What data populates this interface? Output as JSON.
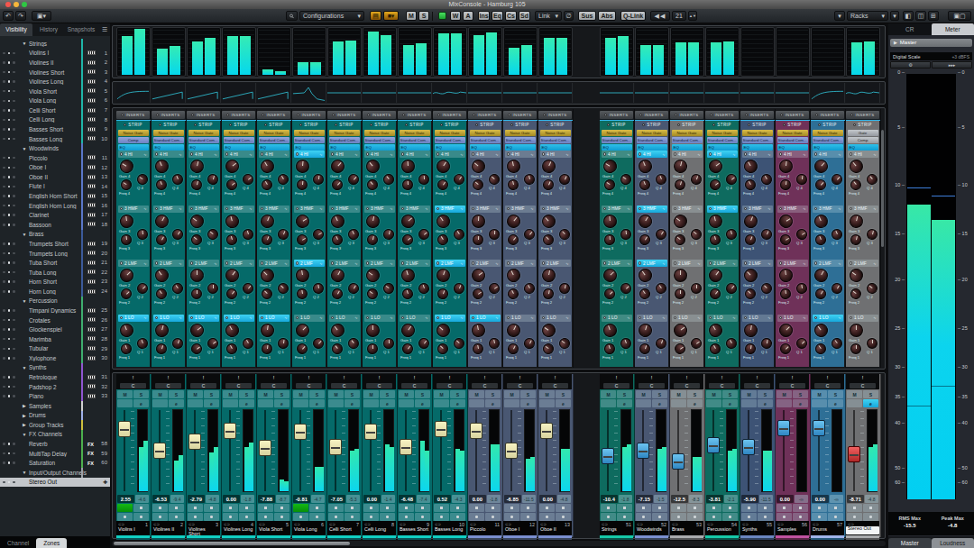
{
  "window": {
    "title": "MixConsole - Hamburg 105"
  },
  "toolbar": {
    "configurations": "Configurations",
    "m": "M",
    "s": "S",
    "w": "W",
    "a": "A",
    "ins": "Ins",
    "eq": "Eq",
    "cs": "Cs",
    "sd": "Sd",
    "link": "Link",
    "sus": "Sus",
    "abs": "Abs",
    "qlink": "Q-Link",
    "count": "21",
    "racks": "Racks"
  },
  "sidebar": {
    "tabs": [
      "Visibility",
      "History",
      "Snapshots"
    ],
    "bottom_tabs": [
      "Channel",
      "Zones"
    ],
    "rows": [
      [
        "g",
        "Strings",
        "",
        "teal"
      ],
      [
        "t",
        "Violins I",
        "1",
        "teal"
      ],
      [
        "t",
        "Violines II",
        "2",
        "teal"
      ],
      [
        "t",
        "Violines Short",
        "3",
        "teal"
      ],
      [
        "t",
        "Violines Long",
        "4",
        "teal"
      ],
      [
        "t",
        "Viola Short",
        "5",
        "teal"
      ],
      [
        "t",
        "Viola Long",
        "6",
        "teal"
      ],
      [
        "t",
        "Celli Short",
        "7",
        "teal"
      ],
      [
        "t",
        "Celli Long",
        "8",
        "teal"
      ],
      [
        "t",
        "Basses Short",
        "9",
        "teal"
      ],
      [
        "t",
        "Basses Long",
        "10",
        "teal"
      ],
      [
        "g",
        "Woodwinds",
        "",
        "slate"
      ],
      [
        "t",
        "Piccolo",
        "11",
        "slate"
      ],
      [
        "t",
        "Oboe I",
        "12",
        "slate"
      ],
      [
        "t",
        "Oboe II",
        "13",
        "slate"
      ],
      [
        "t",
        "Flute I",
        "14",
        "slate"
      ],
      [
        "t",
        "English Horn Short",
        "15",
        "slate"
      ],
      [
        "t",
        "English Horn Long",
        "16",
        "slate"
      ],
      [
        "t",
        "Clarinet",
        "17",
        "slate"
      ],
      [
        "t",
        "Bassoon",
        "18",
        "slate"
      ],
      [
        "g",
        "Brass",
        "",
        "navy"
      ],
      [
        "t",
        "Trumpets Short",
        "19",
        "navy"
      ],
      [
        "t",
        "Trumpets Long",
        "20",
        "navy"
      ],
      [
        "t",
        "Tuba Short",
        "21",
        "navy"
      ],
      [
        "t",
        "Tuba Long",
        "22",
        "navy"
      ],
      [
        "t",
        "Horn Short",
        "23",
        "navy"
      ],
      [
        "t",
        "Horn Long",
        "24",
        "navy"
      ],
      [
        "g",
        "Percussion",
        "",
        "green"
      ],
      [
        "t",
        "Timpani Dynamics",
        "25",
        "green"
      ],
      [
        "t",
        "Crotales",
        "26",
        "green"
      ],
      [
        "t",
        "Glockenspiel",
        "27",
        "green"
      ],
      [
        "t",
        "Marimba",
        "28",
        "green"
      ],
      [
        "t",
        "Tubular",
        "29",
        "green"
      ],
      [
        "t",
        "Xylophone",
        "30",
        "green"
      ],
      [
        "g",
        "Synths",
        "",
        "purple"
      ],
      [
        "t",
        "Retrologue",
        "31",
        "purple"
      ],
      [
        "t",
        "Padshop 2",
        "32",
        "purple"
      ],
      [
        "t",
        "Piano",
        "33",
        "purple"
      ],
      [
        "c",
        "Samples",
        "",
        "white"
      ],
      [
        "c",
        "Drums",
        "",
        "lav"
      ],
      [
        "c",
        "Group Tracks",
        "",
        "yellow"
      ],
      [
        "g",
        "FX Channels",
        "",
        "fxgreen"
      ],
      [
        "f",
        "Reverb",
        "58",
        "fxgreen"
      ],
      [
        "f",
        "MultiTap Delay",
        "59",
        "fxgreen"
      ],
      [
        "f",
        "Saturation",
        "60",
        "fxgreen"
      ],
      [
        "g",
        "Input/Output Channels",
        "",
        "io"
      ],
      [
        "s",
        "Stereo Out",
        "",
        "io"
      ]
    ],
    "strip_colors": {
      "teal": "#1fb5a8",
      "slate": "#5a77c8",
      "navy": "#3c5a9a",
      "green": "#3fae6e",
      "purple": "#9055d0",
      "white": "#cfcfcf",
      "lav": "#9fb0e8",
      "yellow": "#cdbf3e",
      "fxgreen": "#4db04d",
      "io": "#9aa0a6"
    }
  },
  "racks": {
    "inserts_label": "INSERTS",
    "strip_label": "STRIP",
    "bands": [
      {
        "id": "4 HI",
        "gain": "Gain 4",
        "freq": "Freq 4",
        "q": "Q 4"
      },
      {
        "id": "3 HMF",
        "gain": "Gain 3",
        "freq": "Freq 3",
        "q": "Q 3"
      },
      {
        "id": "2 LMF",
        "gain": "Gain 2",
        "freq": "Freq 2",
        "q": "Q 2"
      },
      {
        "id": "1 LO",
        "gain": "Gain 1",
        "freq": "Freq 1",
        "q": "Q 1"
      }
    ]
  },
  "mixer": {
    "colors": {
      "teal": {
        "base": "#056a69",
        "dark": "#03393c",
        "mid": "#0a5256",
        "bright": "#11cfc3"
      },
      "slate": {
        "base": "#495772",
        "dark": "#272e40",
        "mid": "#394459",
        "bright": "#7a8fd0"
      },
      "grey": {
        "base": "#6f7072",
        "dark": "#3b3c3e",
        "mid": "#545557",
        "bright": "#a9abae"
      },
      "green": {
        "base": "#0e6b5f",
        "dark": "#073a33",
        "mid": "#0b5249",
        "bright": "#16c9a8"
      },
      "navy": {
        "base": "#3d5375",
        "dark": "#202c42",
        "mid": "#2f405c",
        "bright": "#6a86c0"
      },
      "magenta": {
        "base": "#6f3159",
        "dark": "#3e1a31",
        "mid": "#572645",
        "bright": "#c052a0"
      },
      "blue": {
        "base": "#2e6f96",
        "dark": "#183f58",
        "mid": "#235676",
        "bright": "#9fb4ea"
      }
    },
    "channels": [
      {
        "name": "Violins I",
        "num": "1",
        "color": "teal",
        "cap": "cream",
        "mods": [
          "Noise Gate",
          "Comp",
          "EQ"
        ],
        "br": [
          78,
          92
        ],
        "m": [
          55,
          62
        ],
        "f": 0.18,
        "v": "2.55",
        "p": "-4.6",
        "mon": true,
        "hl": [
          1
        ],
        "auto": "rise"
      },
      {
        "name": "Violines II",
        "num": "2",
        "color": "teal",
        "cap": "cream",
        "mods": [
          "Noise Gate",
          "Standard Com...",
          "EQ"
        ],
        "br": [
          52,
          58
        ],
        "m": [
          38,
          45
        ],
        "f": 0.5,
        "v": "-6.53",
        "p": "-9.4",
        "hl": [
          1
        ],
        "auto": "ramp"
      },
      {
        "name": "Violines Short",
        "num": "3",
        "color": "teal",
        "cap": "cream",
        "mods": [
          "Noise Gate",
          "Standard Com...",
          "EQ"
        ],
        "br": [
          68,
          75
        ],
        "m": [
          48,
          55
        ],
        "f": 0.36,
        "v": "-2.79",
        "p": "-4.8",
        "hl": [
          1
        ],
        "auto": "ramp"
      },
      {
        "name": "Violines Long",
        "num": "4",
        "color": "teal",
        "cap": "cream",
        "mods": [
          "Noise Gate",
          "Standard Com...",
          "EQ"
        ],
        "br": [
          78,
          78
        ],
        "m": [
          55,
          60
        ],
        "f": 0.2,
        "v": "0.00",
        "p": "-1.8",
        "hl": [
          1
        ],
        "auto": "ramp"
      },
      {
        "name": "Viola Short",
        "num": "5",
        "color": "teal",
        "cap": "cream",
        "mods": [
          "Noise Gate",
          "Standard Com...",
          "EQ"
        ],
        "br": [
          11,
          8
        ],
        "m": [
          14,
          12
        ],
        "f": 0.46,
        "v": "-7.88",
        "p": "-8.7",
        "hl": [
          1
        ],
        "auto": "ramp"
      },
      {
        "name": "Viola Long",
        "num": "6",
        "color": "teal",
        "cap": "cream",
        "mods": [
          "Noise Gate",
          "Standard Com...",
          "EQ"
        ],
        "br": [
          26,
          26
        ],
        "m": [
          30,
          30
        ],
        "f": 0.22,
        "v": "-0.81",
        "p": "-4.7",
        "mon": true,
        "hl": [
          4,
          2
        ],
        "auto": "peak"
      },
      {
        "name": "Celli Short",
        "num": "7",
        "color": "teal",
        "cap": "cream",
        "mods": [
          "Noise Gate",
          "Standard Com...",
          "EQ"
        ],
        "br": [
          68,
          70
        ],
        "m": [
          50,
          52
        ],
        "f": 0.45,
        "v": "-7.05",
        "p": "-5.3",
        "auto": "flat"
      },
      {
        "name": "Celli Long",
        "num": "8",
        "color": "teal",
        "cap": "cream",
        "mods": [
          "Noise Gate",
          "Standard Com...",
          "EQ"
        ],
        "br": [
          88,
          80
        ],
        "m": [
          58,
          55
        ],
        "f": 0.22,
        "v": "0.00",
        "p": "-1.4",
        "auto": "flat"
      },
      {
        "name": "Basses Short",
        "num": "9",
        "color": "teal",
        "cap": "cream",
        "mods": [
          "Noise Gate",
          "Standard Com...",
          "EQ"
        ],
        "br": [
          60,
          63
        ],
        "m": [
          62,
          50
        ],
        "f": 0.45,
        "v": "-6.48",
        "p": "-7.4",
        "auto": "flat"
      },
      {
        "name": "Basses Long",
        "num": "10",
        "color": "teal",
        "cap": "cream",
        "mods": [
          "Noise Gate",
          "Standard Com...",
          "EQ"
        ],
        "br": [
          83,
          83
        ],
        "m": [
          52,
          50
        ],
        "f": 0.18,
        "v": "0.52",
        "p": "-4.3",
        "hl": [
          3,
          2,
          1
        ],
        "auto": "wave"
      },
      {
        "name": "Piccolo",
        "num": "11",
        "color": "slate",
        "cap": "cream",
        "mods": [
          "Noise Gate",
          "Standard Com...",
          "EQ"
        ],
        "br": [
          80,
          85
        ],
        "m": [
          58,
          58
        ],
        "f": 0.2,
        "v": "0.00",
        "p": "-1.8",
        "hl": [
          1
        ],
        "auto": "flat"
      },
      {
        "name": "Oboe I",
        "num": "12",
        "color": "slate",
        "cap": "cream",
        "mods": [
          "Noise Gate",
          "Standard Com...",
          "EQ"
        ],
        "br": [
          55,
          60
        ],
        "m": [
          40,
          42
        ],
        "f": 0.5,
        "v": "-6.85",
        "p": "-11.5",
        "auto": "flat"
      },
      {
        "name": "Oboe II",
        "num": "13",
        "color": "slate",
        "cap": "cream",
        "mods": [
          "Noise Gate",
          "Standard Com...",
          "EQ"
        ],
        "br": [
          75,
          75
        ],
        "m": [
          52,
          52
        ],
        "f": 0.2,
        "v": "0.00",
        "p": "-4.8",
        "auto": "flat"
      },
      {
        "name": "Strings",
        "num": "51",
        "color": "green",
        "cap": "bluecap",
        "grp2": true,
        "mods": [
          "Noise Gate",
          "Standard Com...",
          "EQ"
        ],
        "br": [
          75,
          78
        ],
        "m": [
          55,
          58
        ],
        "f": 0.58,
        "v": "-10.4",
        "p": "-1.8",
        "auto": "flat"
      },
      {
        "name": "Woodwinds",
        "num": "52",
        "color": "slate",
        "cap": "bluecap",
        "mods": [
          "Noise Gate",
          "Standard Com...",
          "EQ"
        ],
        "br": [
          60,
          60
        ],
        "m": [
          52,
          55
        ],
        "f": 0.5,
        "v": "-7.15",
        "p": "-1.5",
        "hl": [
          4,
          3,
          2
        ],
        "auto": "flat"
      },
      {
        "name": "Brass",
        "num": "53",
        "color": "grey",
        "cap": "bluecap",
        "mods": [
          "Noise Gate",
          "Standard Com...",
          "EQ"
        ],
        "br": [
          65,
          65
        ],
        "m": [
          42,
          42
        ],
        "f": 0.66,
        "v": "-12.5",
        "p": "-8.3",
        "auto": "flat"
      },
      {
        "name": "Percussion",
        "num": "54",
        "color": "green",
        "cap": "bluecap",
        "mods": [
          "Noise Gate",
          "Standard Com...",
          "EQ"
        ],
        "br": [
          65,
          68
        ],
        "m": [
          50,
          52
        ],
        "f": 0.42,
        "v": "-3.81",
        "p": "-2.1",
        "hl": [
          4,
          3
        ],
        "auto": "flat"
      },
      {
        "name": "Synths",
        "num": "55",
        "color": "navy",
        "cap": "bluecap",
        "mods": [
          "Noise Gate",
          "Standard Com...",
          "EQ"
        ],
        "br": [
          0,
          0
        ],
        "m": [
          50,
          50
        ],
        "f": 0.45,
        "v": "-5.90",
        "p": "-11.5",
        "auto": "flat"
      },
      {
        "name": "Samples",
        "num": "56",
        "color": "magenta",
        "cap": "bluecap",
        "mods": [
          "Noise Gate",
          "Standard Com...",
          "EQ"
        ],
        "br": [
          0,
          0
        ],
        "m": [
          0,
          0
        ],
        "f": 0.16,
        "v": "0.00",
        "p": "-∞",
        "auto": "flat"
      },
      {
        "name": "Drums",
        "num": "57",
        "color": "blue",
        "cap": "bluecap",
        "mods": [
          "Noise Gate",
          "Standard Com...",
          "EQ"
        ],
        "br": [
          0,
          0
        ],
        "m": [
          0,
          0
        ],
        "f": 0.16,
        "v": "0.00",
        "p": "-∞",
        "hl": [
          1
        ],
        "auto": "rise"
      },
      {
        "name": "Stereo Out",
        "num": "",
        "color": "grey",
        "cap": "redcap",
        "sel": true,
        "mods": [
          "Gate",
          "Comp",
          "EQ"
        ],
        "br": [
          65,
          68
        ],
        "m": [
          55,
          58
        ],
        "f": 0.56,
        "v": "-8.71",
        "p": "-4.8",
        "auto": "wave"
      }
    ]
  },
  "master": {
    "tabs": [
      "CR",
      "Meter"
    ],
    "header": "Master",
    "digital_scale_label": "Digital Scale",
    "digital_scale_value": "+3 dBFS",
    "ticks": [
      [
        "0",
        0
      ],
      [
        "5",
        0.129
      ],
      [
        "10",
        0.264
      ],
      [
        "15",
        0.38
      ],
      [
        "20",
        0.487
      ],
      [
        "25",
        0.601
      ],
      [
        "30",
        0.692
      ],
      [
        "35",
        0.762
      ],
      [
        "40",
        0.825
      ],
      [
        "50",
        0.93
      ],
      [
        "60",
        0.964
      ]
    ],
    "bars": {
      "left_top": 0.308,
      "right_top": 0.343,
      "peak_l": 0.268,
      "peak_r": 0.287,
      "line_l": 0.78,
      "line_r": 0.734
    },
    "rms_label": "RMS Max",
    "rms_value": "-15.5",
    "peak_label": "Peak Max",
    "peak_value": "-4.8",
    "bottom_tabs": [
      "Master",
      "Loudness"
    ]
  }
}
